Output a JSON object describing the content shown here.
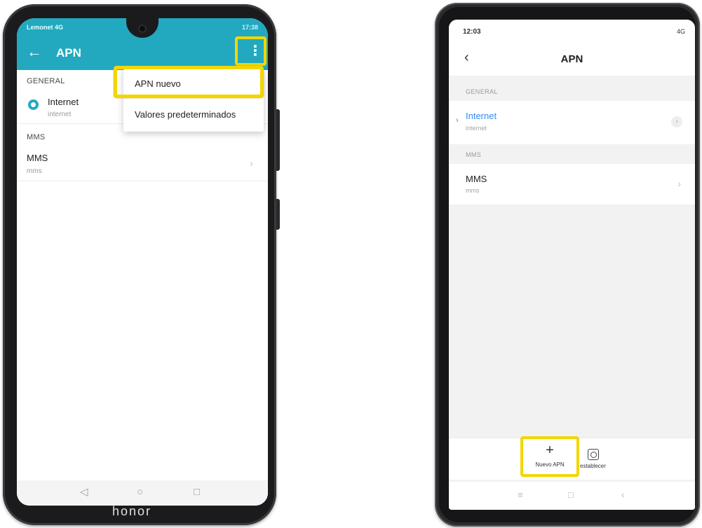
{
  "left_phone": {
    "status": {
      "carrier": "Lemonet 4G",
      "right": "17:38"
    },
    "title": "APN",
    "sections": {
      "general": "GENERAL",
      "mms": "MMS"
    },
    "apns": [
      {
        "name": "Internet",
        "apn": "internet"
      },
      {
        "name": "MMS",
        "apn": "mms"
      }
    ],
    "menu": {
      "items": [
        "APN nuevo",
        "Valores predeterminados"
      ]
    },
    "brand": "honor",
    "icons": {
      "back": "back-arrow-icon",
      "more": "more-vertical-icon",
      "nav_back": "nav-back-icon",
      "nav_home": "nav-home-icon",
      "nav_recent": "nav-recent-icon"
    },
    "accent_color": "#22a9bf",
    "highlight_color": "#f2d600"
  },
  "right_phone": {
    "status": {
      "time": "12:03",
      "right": "4G"
    },
    "title": "APN",
    "sections": {
      "general": "GENERAL",
      "mms": "MMS"
    },
    "apns": [
      {
        "name": "Internet",
        "apn": "internet",
        "selected": true
      },
      {
        "name": "MMS",
        "apn": "mms",
        "selected": false
      }
    ],
    "bottom_actions": {
      "new_apn": "Nuevo APN",
      "reset": "establecer"
    },
    "icons": {
      "back": "chevron-left-icon",
      "add": "plus-icon",
      "reset": "reset-icon",
      "nav_menu": "nav-menu-icon",
      "nav_home": "nav-home-icon",
      "nav_back": "nav-back-icon"
    },
    "accent_color": "#2f8ef2",
    "highlight_color": "#f2d600"
  }
}
